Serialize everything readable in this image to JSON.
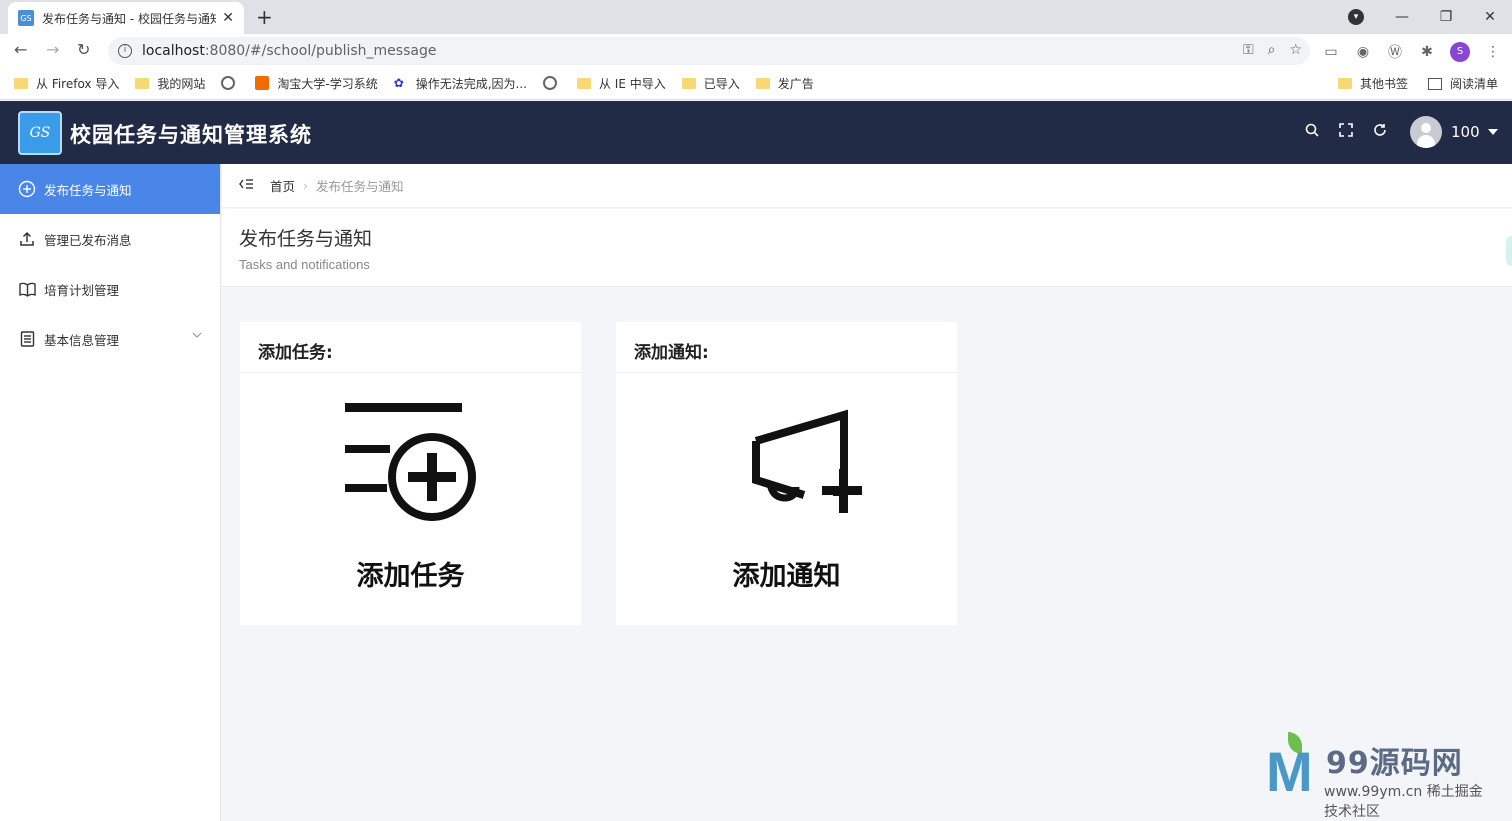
{
  "browser": {
    "tab_title": "发布任务与通知 - 校园任务与通知",
    "tab_favicon_text": "GS",
    "new_tab_icon": "+",
    "close_icon": "✕",
    "url_host": "localhost",
    "url_path": ":8080/#/school/publish_message",
    "profile_avatar_letter": "S",
    "bookmarks": [
      {
        "label": "从 Firefox 导入",
        "icon": "folder"
      },
      {
        "label": "我的网站",
        "icon": "folder"
      },
      {
        "label": "",
        "icon": "globe"
      },
      {
        "label": "淘宝大学-学习系统",
        "icon": "taobao"
      },
      {
        "label": "操作无法完成,因为...",
        "icon": "baidu"
      },
      {
        "label": "",
        "icon": "globe"
      },
      {
        "label": "从 IE 中导入",
        "icon": "folder"
      },
      {
        "label": "已导入",
        "icon": "folder"
      },
      {
        "label": "发广告",
        "icon": "folder"
      }
    ],
    "bookmarks_right": [
      {
        "label": "其他书签",
        "icon": "folder"
      },
      {
        "label": "阅读清单",
        "icon": "list"
      }
    ]
  },
  "app": {
    "logo_text": "GS",
    "title": "校园任务与通知管理系统",
    "user_name": "100",
    "accent_color": "#4a85e8",
    "header_bg": "#222b45"
  },
  "sidebar": {
    "items": [
      {
        "label": "发布任务与通知",
        "icon": "plus-circle-icon",
        "active": true
      },
      {
        "label": "管理已发布消息",
        "icon": "upload-icon",
        "active": false
      },
      {
        "label": "培育计划管理",
        "icon": "book-icon",
        "active": false
      },
      {
        "label": "基本信息管理",
        "icon": "document-icon",
        "active": false,
        "expandable": true
      }
    ]
  },
  "breadcrumb": {
    "home": "首页",
    "current": "发布任务与通知"
  },
  "page": {
    "title": "发布任务与通知",
    "subtitle": "Tasks and notifications"
  },
  "cards": [
    {
      "header": "添加任务:",
      "label": "添加任务",
      "icon": "task-add-icon"
    },
    {
      "header": "添加通知:",
      "label": "添加通知",
      "icon": "megaphone-add-icon"
    }
  ],
  "watermark": {
    "brand": "99源码网",
    "url": "www.99ym.cn 稀土掘金技术社区"
  }
}
